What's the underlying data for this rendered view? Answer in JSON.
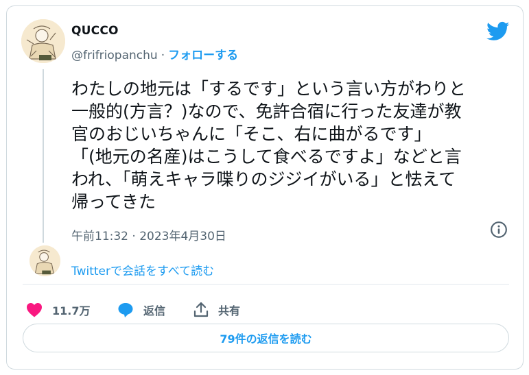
{
  "author": {
    "display_name": "QUCCO",
    "handle": "@frifriopanchu",
    "separator": "·",
    "follow_label": "フォローする"
  },
  "tweet": {
    "lines": [
      "わたしの地元は「するです」という言い方がわりと",
      "一般的(方言？)なので、免許合宿に行った友達が教",
      "官のおじいちゃんに「そこ、右に曲がるです」",
      "「(地元の名産)はこうして食べるですよ」などと言",
      "われ、「萌えキャラ喋りのジジイがいる」と怯えて",
      "帰ってきた"
    ],
    "timestamp": "午前11:32 · 2023年4月30日"
  },
  "conversation_link": "Twitterで会話をすべて読む",
  "actions": {
    "likes": "11.7万",
    "reply_label": "返信",
    "share_label": "共有"
  },
  "replies_button": "79件の返信を読む",
  "colors": {
    "accent": "#1d9bf0",
    "like": "#f91880",
    "muted": "#536471",
    "text": "#0f1419",
    "border": "#cfd9de"
  },
  "icons": [
    "twitter-bird-icon",
    "info-icon",
    "heart-icon",
    "speech-bubble-icon",
    "share-icon"
  ]
}
